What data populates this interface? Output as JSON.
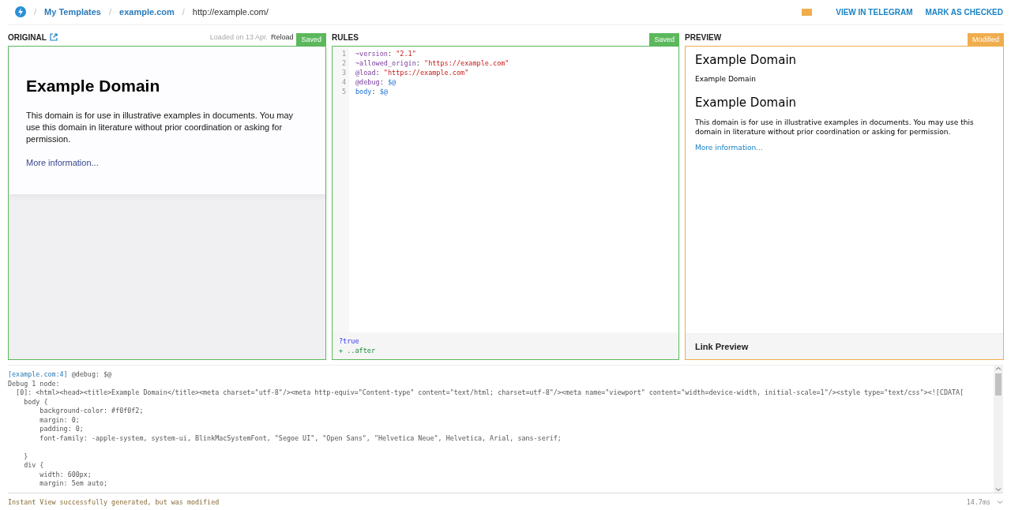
{
  "breadcrumb": {
    "separator": "/",
    "items": [
      {
        "label": "My Templates",
        "kind": "link"
      },
      {
        "label": "example.com",
        "kind": "link"
      },
      {
        "label": "http://example.com/",
        "kind": "text"
      }
    ]
  },
  "header_actions": {
    "color": "#f0ad4e",
    "links": [
      "VIEW IN TELEGRAM",
      "MARK AS CHECKED"
    ]
  },
  "original": {
    "title": "ORIGINAL",
    "loaded": "Loaded on 13 Apr.",
    "reload": "Reload",
    "status": {
      "label": "Saved",
      "kind": "saved"
    },
    "page": {
      "heading": "Example Domain",
      "text": "This domain is for use in illustrative examples in documents. You may use this domain in literature without prior coordination or asking for permission.",
      "link": "More information..."
    }
  },
  "rules": {
    "title": "RULES",
    "status": {
      "label": "Saved",
      "kind": "saved"
    },
    "lines": [
      {
        "number": "1",
        "tokens": [
          {
            "text": "~version",
            "kind": "key"
          },
          {
            "text": ": ",
            "kind": "plain"
          },
          {
            "text": "\"2.1\"",
            "kind": "string"
          }
        ]
      },
      {
        "number": "2",
        "tokens": [
          {
            "text": "~allowed_origin",
            "kind": "key"
          },
          {
            "text": ": ",
            "kind": "plain"
          },
          {
            "text": "\"https://example.com\"",
            "kind": "string"
          }
        ]
      },
      {
        "number": "3",
        "tokens": [
          {
            "text": "@load",
            "kind": "key"
          },
          {
            "text": ": ",
            "kind": "plain"
          },
          {
            "text": "\"https://example.com\"",
            "kind": "string"
          }
        ]
      },
      {
        "number": "4",
        "tokens": [
          {
            "text": "@debug",
            "kind": "key"
          },
          {
            "text": ": ",
            "kind": "plain"
          },
          {
            "text": "$@",
            "kind": "var"
          }
        ]
      },
      {
        "number": "5",
        "tokens": [
          {
            "text": "body",
            "kind": "property"
          },
          {
            "text": ": ",
            "kind": "plain"
          },
          {
            "text": "$@",
            "kind": "var"
          }
        ]
      }
    ],
    "result": [
      {
        "text": "?true",
        "kind": "condition"
      },
      {
        "text": "+ ..after",
        "kind": "added"
      }
    ]
  },
  "preview": {
    "title": "PREVIEW",
    "status": {
      "label": "Modified",
      "kind": "modified"
    },
    "blocks": [
      {
        "text": "Example Domain",
        "kind": "heading"
      },
      {
        "text": "Example Domain",
        "kind": "kicker"
      },
      {
        "text": "Example Domain",
        "kind": "heading"
      },
      {
        "text": "This domain is for use in illustrative examples in documents. You may use this domain in literature without prior coordination or asking for permission.",
        "kind": "paragraph"
      },
      {
        "text": "More information...",
        "kind": "link"
      }
    ],
    "footer": "Link Preview"
  },
  "log": {
    "lines": [
      {
        "source": "[example.com:4]",
        "text": " @debug: $@"
      },
      {
        "text": "Debug 1 node:"
      },
      {
        "text": "  [0]: <html><head><title>Example Domain</title><meta charset=\"utf-8\"/><meta http-equiv=\"Content-type\" content=\"text/html; charset=utf-8\"/><meta name=\"viewport\" content=\"width=device-width, initial-scale=1\"/><style type=\"text/css\"><![CDATA["
      },
      {
        "text": "    body {"
      },
      {
        "text": "        background-color: #f0f0f2;"
      },
      {
        "text": "        margin: 0;"
      },
      {
        "text": "        padding: 0;"
      },
      {
        "text": "        font-family: -apple-system, system-ui, BlinkMacSystemFont, \"Segoe UI\", \"Open Sans\", \"Helvetica Neue\", Helvetica, Arial, sans-serif;"
      },
      {
        "kind": "blank"
      },
      {
        "text": "    }"
      },
      {
        "text": "    div {"
      },
      {
        "text": "        width: 600px;"
      },
      {
        "text": "        margin: 5em auto;"
      }
    ]
  },
  "status_bar": {
    "message": "Instant View successfully generated, but was modified",
    "timing": "14.7ms"
  }
}
